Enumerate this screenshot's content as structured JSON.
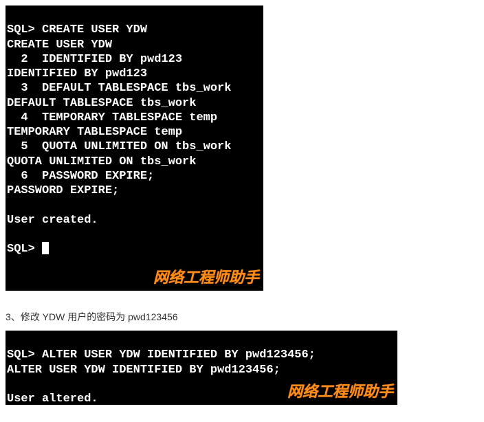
{
  "terminal1": {
    "lines": [
      "SQL> CREATE USER YDW",
      "CREATE USER YDW",
      "  2  IDENTIFIED BY pwd123",
      "IDENTIFIED BY pwd123",
      "  3  DEFAULT TABLESPACE tbs_work",
      "DEFAULT TABLESPACE tbs_work",
      "  4  TEMPORARY TABLESPACE temp",
      "TEMPORARY TABLESPACE temp",
      "  5  QUOTA UNLIMITED ON tbs_work",
      "QUOTA UNLIMITED ON tbs_work",
      "  6  PASSWORD EXPIRE;",
      "PASSWORD EXPIRE;",
      "",
      "User created.",
      "",
      "SQL> "
    ],
    "watermark": "网络工程师助手"
  },
  "section_text": "3、修改 YDW 用户的密码为 pwd123456",
  "terminal2": {
    "lines": [
      "SQL> ALTER USER YDW IDENTIFIED BY pwd123456;",
      "ALTER USER YDW IDENTIFIED BY pwd123456;",
      "",
      "User altered."
    ],
    "watermark": "网络工程师助手"
  }
}
